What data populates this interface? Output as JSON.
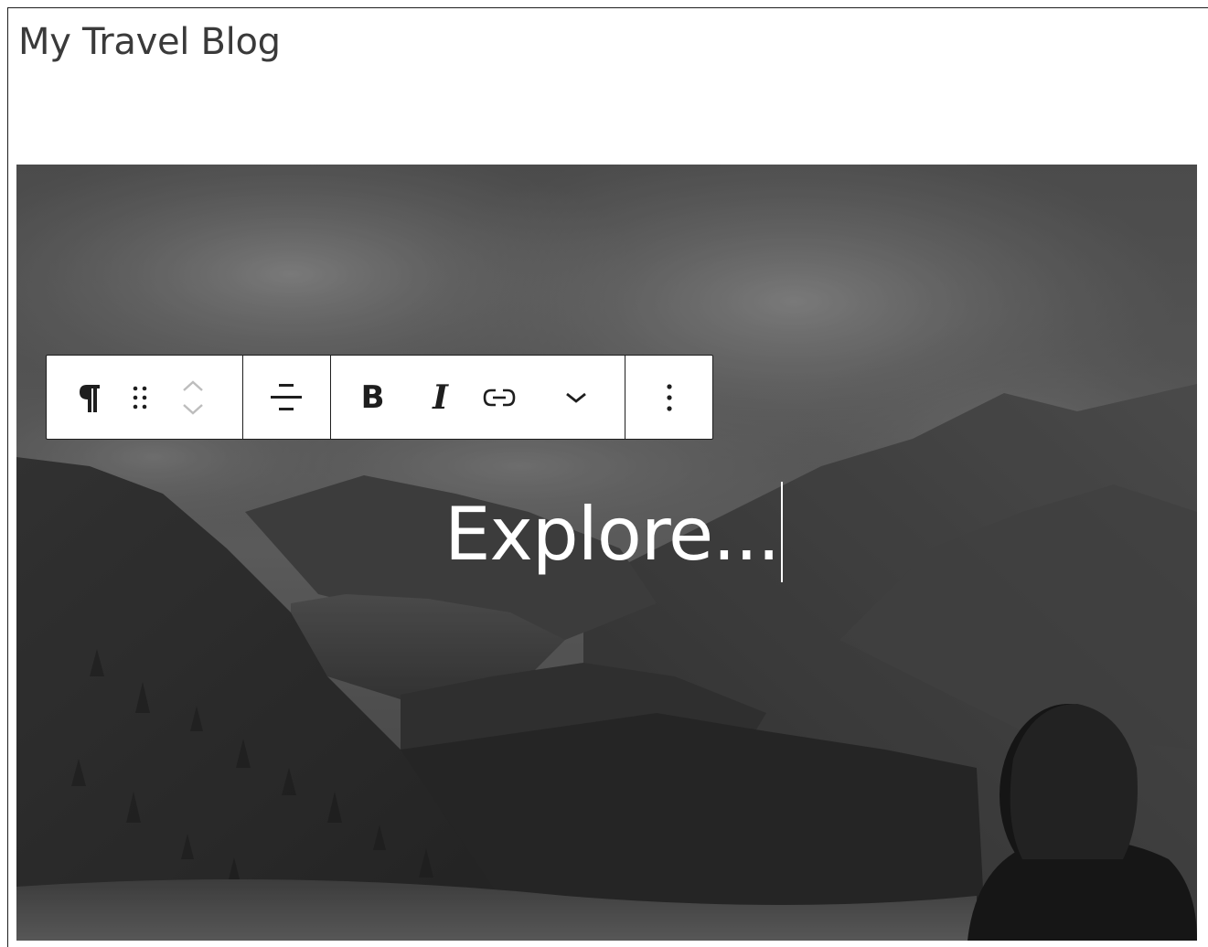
{
  "site": {
    "title": "My Travel Blog"
  },
  "cover": {
    "text": "Explore..."
  },
  "toolbar": {
    "buttons": [
      {
        "name": "paragraph",
        "icon": "paragraph-icon"
      },
      {
        "name": "drag",
        "icon": "drag-handle-icon"
      },
      {
        "name": "move-up",
        "icon": "chevron-up-icon"
      },
      {
        "name": "move-down",
        "icon": "chevron-down-icon"
      },
      {
        "name": "align",
        "icon": "align-center-icon"
      },
      {
        "name": "bold",
        "icon": "bold-icon"
      },
      {
        "name": "italic",
        "icon": "italic-icon"
      },
      {
        "name": "link",
        "icon": "link-icon"
      },
      {
        "name": "more-rich-text",
        "icon": "chevron-down-icon"
      },
      {
        "name": "options",
        "icon": "more-vertical-icon"
      }
    ]
  },
  "colors": {
    "toolbar_bg": "#ffffff",
    "toolbar_border": "#1e1e1e",
    "title_text": "#3a3a3a",
    "cover_text": "#ffffff"
  }
}
